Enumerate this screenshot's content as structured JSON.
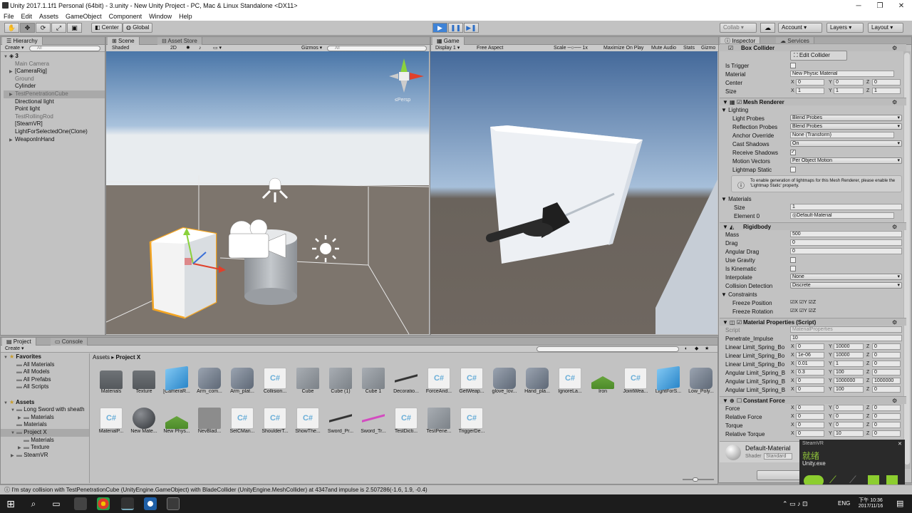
{
  "window": {
    "title": "Unity 2017.1.1f1 Personal (64bit) - 3.unity - New Unity Project - PC, Mac & Linux Standalone <DX11>"
  },
  "menu": [
    "File",
    "Edit",
    "Assets",
    "GameObject",
    "Component",
    "Window",
    "Help"
  ],
  "toolbar": {
    "pivot": "Center",
    "space": "Global",
    "collab": "Collab ▾",
    "account": "Account",
    "layers": "Layers",
    "layout": "Layout"
  },
  "hierarchy": {
    "tab": "Hierarchy",
    "create": "Create ▾",
    "search_placeholder": "All",
    "scene": "3",
    "items": [
      {
        "label": "Main Camera",
        "gray": true,
        "arrow": ""
      },
      {
        "label": "[CameraRig]",
        "gray": false,
        "arrow": "▶"
      },
      {
        "label": "Ground",
        "gray": true,
        "arrow": ""
      },
      {
        "label": "Cylinder",
        "gray": false,
        "arrow": ""
      },
      {
        "label": "TestPenetrationCube",
        "gray": true,
        "arrow": "▶",
        "selected": true
      },
      {
        "label": "Directional light",
        "gray": false,
        "arrow": ""
      },
      {
        "label": "Point light",
        "gray": false,
        "arrow": ""
      },
      {
        "label": "TestRollingRod",
        "gray": true,
        "arrow": ""
      },
      {
        "label": "[SteamVR]",
        "gray": false,
        "arrow": ""
      },
      {
        "label": "LightForSelectedOne(Clone)",
        "gray": false,
        "arrow": ""
      },
      {
        "label": "WeaponInHand",
        "gray": false,
        "arrow": "▶"
      }
    ]
  },
  "scene": {
    "tab_scene": "Scene",
    "tab_store": "Asset Store",
    "shading": "Shaded",
    "mode2d": "2D",
    "gizmos": "Gizmos ▾",
    "search": "All",
    "persp": "≤Persp"
  },
  "game": {
    "tab": "Game",
    "display": "Display 1",
    "aspect": "Free Aspect",
    "scale_label": "Scale",
    "scale_value": "1x",
    "maximize": "Maximize On Play",
    "mute": "Mute Audio",
    "stats": "Stats",
    "gizmos": "Gizmo"
  },
  "inspector": {
    "tab": "Inspector",
    "tab2": "Services",
    "box_collider": {
      "title": "Box Collider",
      "edit": "Edit Collider",
      "is_trigger": "Is Trigger",
      "material_label": "Material",
      "material": "New Physic Material",
      "center_label": "Center",
      "size_label": "Size",
      "center": {
        "x": "0",
        "y": "0",
        "z": "0"
      },
      "size": {
        "x": "1",
        "y": "1",
        "z": "1"
      }
    },
    "mesh_renderer": {
      "title": "Mesh Renderer",
      "lighting": "Lighting",
      "rows": [
        {
          "label": "Light Probes",
          "value": "Blend Probes"
        },
        {
          "label": "Reflection Probes",
          "value": "Blend Probes"
        },
        {
          "label": "Anchor Override",
          "value": "None (Transform)"
        },
        {
          "label": "Cast Shadows",
          "value": "On"
        }
      ],
      "receive_shadows": "Receive Shadows",
      "motion_vectors": "Motion Vectors",
      "motion_value": "Per Object Motion",
      "lightmap_static": "Lightmap Static",
      "help": "To enable generation of lightmaps for this Mesh Renderer, please enable the 'Lightmap Static' property.",
      "materials": "Materials",
      "size_label": "Size",
      "size": "1",
      "element_label": "Element 0",
      "element": "Default-Material"
    },
    "rigidbody": {
      "title": "Rigidbody",
      "rows": [
        {
          "label": "Mass",
          "value": "500"
        },
        {
          "label": "Drag",
          "value": "0"
        },
        {
          "label": "Angular Drag",
          "value": "0"
        }
      ],
      "use_gravity": "Use Gravity",
      "is_kinematic": "Is Kinematic",
      "interpolate": "Interpolate",
      "interpolate_value": "None",
      "collision": "Collision Detection",
      "collision_value": "Discrete",
      "constraints": "Constraints",
      "freeze_pos": "Freeze Position",
      "freeze_rot": "Freeze Rotation"
    },
    "material_props": {
      "title": "Material Properties (Script)",
      "script_label": "Script",
      "script": "MaterialProperties",
      "penetrate_label": "Penetrate_Impulse",
      "penetrate": "10",
      "rows": [
        {
          "label": "Linear Limit_Spring_Bo",
          "x": "0",
          "y": "10000",
          "z": "0"
        },
        {
          "label": "Linear Limit_Spring_Bo",
          "x": "1e-06",
          "y": "10000",
          "z": "0"
        },
        {
          "label": "Linear Limit_Spring_Bo",
          "x": "0.01",
          "y": "1",
          "z": "0"
        },
        {
          "label": "Angular Limit_Spring_B",
          "x": "0.3",
          "y": "100",
          "z": "0"
        },
        {
          "label": "Angular Limit_Spring_B",
          "x": "0",
          "y": "1000000",
          "z": "1000000"
        },
        {
          "label": "Angular Limit_Spring_B",
          "x": "0",
          "y": "100",
          "z": "0"
        }
      ]
    },
    "constant_force": {
      "title": "Constant Force",
      "rows": [
        {
          "label": "Force",
          "x": "0",
          "y": "0",
          "z": "0"
        },
        {
          "label": "Relative Force",
          "x": "0",
          "y": "0",
          "z": "0"
        },
        {
          "label": "Torque",
          "x": "0",
          "y": "0",
          "z": "0"
        },
        {
          "label": "Relative Torque",
          "x": "0",
          "y": "10",
          "z": "0"
        }
      ]
    },
    "material_preview": {
      "name": "Default-Material",
      "shader_label": "Shader",
      "shader": "Standard"
    },
    "add_button": "Add"
  },
  "notification": {
    "title": "SteamVR",
    "chinese": "就绪",
    "exe": "Unity.exe"
  },
  "project": {
    "tab": "Project",
    "tab2": "Console",
    "create": "Create ▾",
    "breadcrumb_root": "Assets",
    "breadcrumb_sep": "▸",
    "breadcrumb_leaf": "Project X",
    "tree": [
      {
        "label": "Favorites",
        "bold": true,
        "indent": 0,
        "arrow": "▼"
      },
      {
        "label": "All Materials",
        "indent": 1,
        "arrow": ""
      },
      {
        "label": "All Models",
        "indent": 1,
        "arrow": ""
      },
      {
        "label": "All Prefabs",
        "indent": 1,
        "arrow": ""
      },
      {
        "label": "All Scripts",
        "indent": 1,
        "arrow": ""
      },
      {
        "label": "",
        "indent": 0,
        "arrow": ""
      },
      {
        "label": "Assets",
        "bold": true,
        "indent": 0,
        "arrow": "▼"
      },
      {
        "label": "Long Sword with sheath",
        "indent": 1,
        "arrow": "▼"
      },
      {
        "label": "Materials",
        "indent": 2,
        "arrow": "▶"
      },
      {
        "label": "Materials",
        "indent": 1,
        "arrow": ""
      },
      {
        "label": "Project X",
        "indent": 1,
        "arrow": "▼",
        "selected": true
      },
      {
        "label": "Materials",
        "indent": 2,
        "arrow": ""
      },
      {
        "label": "Texture",
        "indent": 2,
        "arrow": "▶"
      },
      {
        "label": "SteamVR",
        "indent": 1,
        "arrow": "▶"
      }
    ],
    "assets_row1": [
      {
        "label": "Materials",
        "type": "folder"
      },
      {
        "label": "Texture",
        "type": "folder"
      },
      {
        "label": "[CameraR...",
        "type": "cube"
      },
      {
        "label": "Arm_com...",
        "type": "mesh"
      },
      {
        "label": "Arm_plat...",
        "type": "mesh"
      },
      {
        "label": "Collision...",
        "type": "cs"
      },
      {
        "label": "Cube",
        "type": "graycube"
      },
      {
        "label": "Cube (1)",
        "type": "graycube"
      },
      {
        "label": "Cube 1",
        "type": "graycube"
      },
      {
        "label": "Decoratio...",
        "type": "rod"
      },
      {
        "label": "ForceAnd...",
        "type": "cs"
      },
      {
        "label": "GetWeap...",
        "type": "cs"
      },
      {
        "label": "glove_lov...",
        "type": "mesh"
      },
      {
        "label": "Hand_pla...",
        "type": "mesh"
      },
      {
        "label": "IgnoreLa...",
        "type": "cs"
      },
      {
        "label": "Iron",
        "type": "physic"
      },
      {
        "label": "JointWea...",
        "type": "cs"
      },
      {
        "label": "LightForS...",
        "type": "cube"
      },
      {
        "label": "Low_Poly...",
        "type": "mesh"
      }
    ],
    "assets_row2": [
      {
        "label": "MaterialP...",
        "type": "cs"
      },
      {
        "label": "New Mate...",
        "type": "sphere"
      },
      {
        "label": "New Phys...",
        "type": "physic"
      },
      {
        "label": "NevBlad...",
        "type": "dark"
      },
      {
        "label": "SetCMan...",
        "type": "cs"
      },
      {
        "label": "ShoulderT...",
        "type": "cs"
      },
      {
        "label": "ShowThe...",
        "type": "cs"
      },
      {
        "label": "Sword_Pr...",
        "type": "rod"
      },
      {
        "label": "Sword_Tr...",
        "type": "pinkrod"
      },
      {
        "label": "TestDicti...",
        "type": "cs"
      },
      {
        "label": "TestPene...",
        "type": "graycube"
      },
      {
        "label": "TriggerDe...",
        "type": "cs"
      }
    ]
  },
  "status": {
    "message": "I'm stay collision with TestPenetrationCube (UnityEngine.GameObject) with BladeCollider (UnityEngine.MeshCollider) at 4347and impulse is 2.507286(-1.6, 1.9, -0.4)"
  },
  "taskbar": {
    "lang": "ENG",
    "time": "下午 10:36",
    "date": "2017/11/16"
  },
  "colors": {
    "play_active": "#3f83d6",
    "selection_orange": "#f5a623",
    "toolbar_bg": "#c2c2c2"
  }
}
